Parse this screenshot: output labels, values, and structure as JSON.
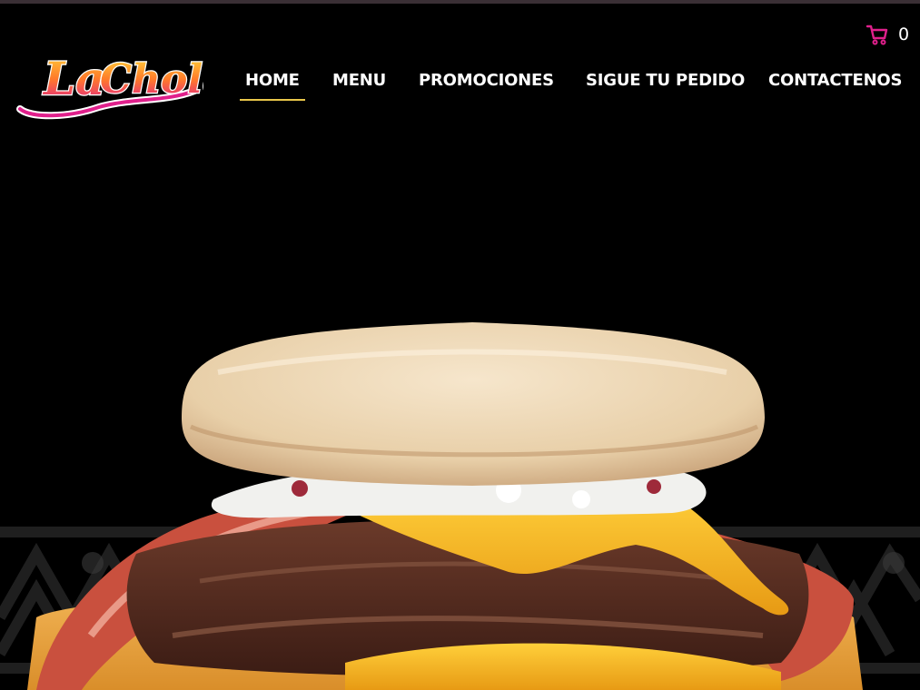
{
  "brand": {
    "name": "La Chola",
    "logo_text": "La Chola"
  },
  "nav": {
    "items": [
      {
        "label": "HOME",
        "active": true
      },
      {
        "label": "MENU",
        "active": false
      },
      {
        "label": "PROMOCIONES",
        "active": false
      },
      {
        "label": "SIGUE TU PEDIDO",
        "active": false
      },
      {
        "label": "CONTACTENOS",
        "active": false
      }
    ]
  },
  "cart": {
    "count": "0",
    "icon": "shopping-cart-icon",
    "color": "#e0208c"
  },
  "hero": {
    "image": "cheeseburger-with-bacon-photo"
  },
  "colors": {
    "background": "#000000",
    "active_underline": "#e8c64a",
    "nav_text": "#ffffff"
  }
}
